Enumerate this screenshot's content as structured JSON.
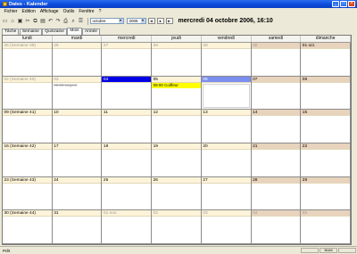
{
  "window": {
    "title": "Dates - Kalender"
  },
  "menu": [
    "Fichier",
    "Edition",
    "Affichage",
    "Outils",
    "Fenêtre",
    "?"
  ],
  "toolbar": {
    "icons": [
      "new-doc-icon",
      "open-icon",
      "save-icon",
      "cut-icon",
      "copy-icon",
      "paste-icon",
      "undo-icon",
      "redo-icon",
      "print-icon",
      "search-icon",
      "list-icon"
    ],
    "month_select": "octobre",
    "year_select": "2006",
    "nav": [
      "◄",
      "●",
      "►"
    ],
    "date_heading": "mercredi 04 octobre 2006, 16:10"
  },
  "tabs": [
    {
      "label": "Tâche",
      "active": false
    },
    {
      "label": "Semaine",
      "active": false
    },
    {
      "label": "Quinzaine",
      "active": false
    },
    {
      "label": "Mois",
      "active": true
    },
    {
      "label": "Année",
      "active": false
    }
  ],
  "calendar": {
    "weekday_headers": [
      "lundi",
      "mardi",
      "mercredi",
      "jeudi",
      "vendredi",
      "samedi",
      "dimanche"
    ],
    "weeks": [
      [
        {
          "label": "25 (Semaine 39)",
          "state": "outside",
          "events": []
        },
        {
          "label": "26",
          "state": "outside",
          "events": []
        },
        {
          "label": "27",
          "state": "outside",
          "events": []
        },
        {
          "label": "28",
          "state": "outside",
          "events": []
        },
        {
          "label": "29",
          "state": "outside",
          "events": []
        },
        {
          "label": "30",
          "state": "outside-weekend",
          "events": []
        },
        {
          "label": "01 oct.",
          "state": "weekend",
          "events": []
        }
      ],
      [
        {
          "label": "02 (Semaine 40)",
          "state": "past",
          "events": []
        },
        {
          "label": "03",
          "state": "past",
          "events": [
            {
              "text": "00:00 Urgent",
              "style": "struck"
            }
          ]
        },
        {
          "label": "04",
          "state": "today",
          "events": []
        },
        {
          "label": "05",
          "state": "",
          "events": [
            {
              "text": "09:00 Coiffeur",
              "style": "yellow"
            }
          ]
        },
        {
          "label": "06",
          "state": "selected",
          "events": []
        },
        {
          "label": "07",
          "state": "weekend",
          "events": []
        },
        {
          "label": "08",
          "state": "weekend",
          "events": []
        }
      ],
      [
        {
          "label": "09 (Semaine 41)",
          "state": "",
          "events": []
        },
        {
          "label": "10",
          "state": "",
          "events": []
        },
        {
          "label": "11",
          "state": "",
          "events": []
        },
        {
          "label": "12",
          "state": "",
          "events": []
        },
        {
          "label": "13",
          "state": "",
          "events": []
        },
        {
          "label": "14",
          "state": "weekend",
          "events": []
        },
        {
          "label": "15",
          "state": "weekend",
          "events": []
        }
      ],
      [
        {
          "label": "16 (Semaine 42)",
          "state": "",
          "events": []
        },
        {
          "label": "17",
          "state": "",
          "events": []
        },
        {
          "label": "18",
          "state": "",
          "events": []
        },
        {
          "label": "19",
          "state": "",
          "events": []
        },
        {
          "label": "20",
          "state": "",
          "events": []
        },
        {
          "label": "21",
          "state": "weekend",
          "events": []
        },
        {
          "label": "22",
          "state": "weekend",
          "events": []
        }
      ],
      [
        {
          "label": "23 (Semaine 43)",
          "state": "",
          "events": []
        },
        {
          "label": "24",
          "state": "",
          "events": []
        },
        {
          "label": "25",
          "state": "",
          "events": []
        },
        {
          "label": "26",
          "state": "",
          "events": []
        },
        {
          "label": "27",
          "state": "",
          "events": []
        },
        {
          "label": "28",
          "state": "weekend",
          "events": []
        },
        {
          "label": "29",
          "state": "weekend",
          "events": []
        }
      ],
      [
        {
          "label": "30 (Semaine 44)",
          "state": "",
          "events": []
        },
        {
          "label": "31",
          "state": "",
          "events": []
        },
        {
          "label": "01 nov.",
          "state": "outside",
          "events": []
        },
        {
          "label": "02",
          "state": "outside",
          "events": []
        },
        {
          "label": "03",
          "state": "outside",
          "events": []
        },
        {
          "label": "04",
          "state": "outside-weekend",
          "events": []
        },
        {
          "label": "05",
          "state": "outside-weekend",
          "events": []
        }
      ]
    ]
  },
  "status": {
    "text": "Prêt",
    "panes": [
      "",
      "NUM",
      ""
    ]
  },
  "colors": {
    "today": "#0000e6",
    "selected": "#7b8eef",
    "event_highlight": "#ffff00",
    "weekday_header_band": "#fdf3d8",
    "weekend_band": "#e8d3bd"
  }
}
